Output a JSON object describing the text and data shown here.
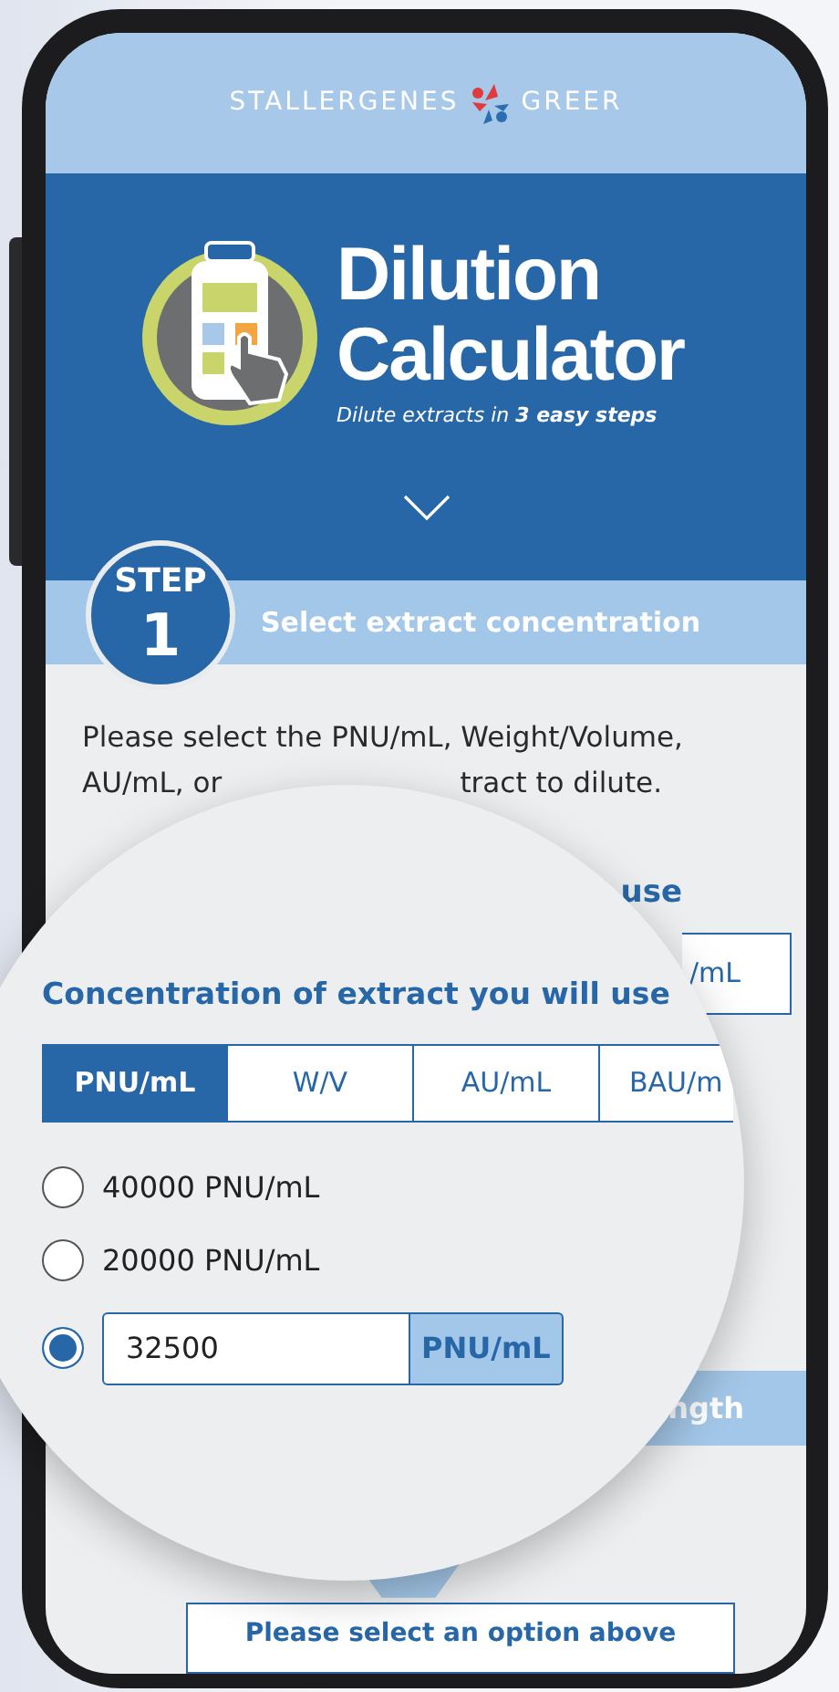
{
  "brand": {
    "left": "STALLERGENES",
    "right": "GREER"
  },
  "hero": {
    "title": "Dilution Calculator",
    "subtitle": "Dilute extracts in **3 easy steps**"
  },
  "step": {
    "label": "STEP",
    "number": "1",
    "title": "Select extract concentration"
  },
  "intro": [
    "Please select the PNU/mL, Weight/Volume,",
    "AU/mL, or",
    "tract to dilute."
  ],
  "behind": {
    "heading": "use",
    "unit_tab": "/mL",
    "step_title": "ngth",
    "button": "Please select an option above"
  },
  "magnifier": {
    "heading": "Concentration of extract you will use",
    "tabs": [
      {
        "label": "PNU/mL",
        "selected": true
      },
      {
        "label": "W/V",
        "selected": false
      },
      {
        "label": "AU/mL",
        "selected": false
      },
      {
        "label": "BAU/m",
        "selected": false
      }
    ],
    "options": [
      {
        "kind": "preset",
        "label": "40000 PNU/mL",
        "selected": false
      },
      {
        "kind": "preset",
        "label": "20000 PNU/mL",
        "selected": false
      },
      {
        "kind": "custom",
        "value": "32500",
        "unit": "PNU/mL",
        "selected": true
      }
    ]
  }
}
